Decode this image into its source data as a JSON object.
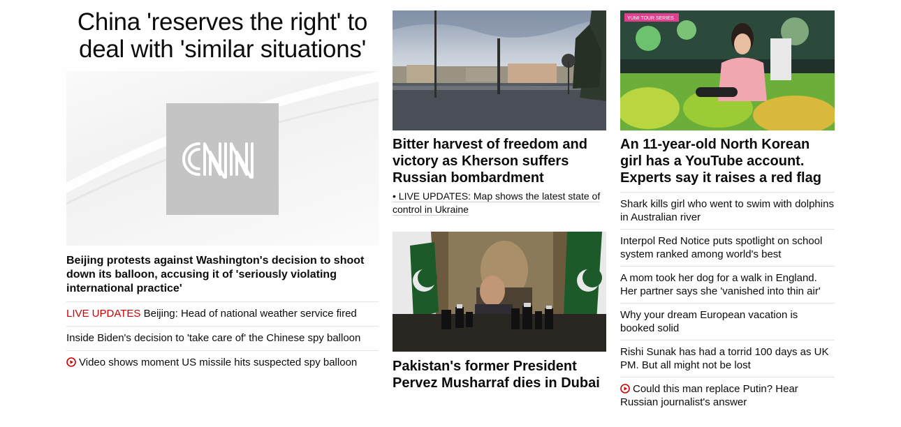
{
  "lead": {
    "headline": "China 'reserves the right' to deal with 'similar situations'",
    "logo_text": "CNN",
    "story_title": "Beijing protests against Washington's decision to shoot down its balloon, accusing it of 'seriously violating international practice'",
    "related": [
      {
        "tag": "LIVE UPDATES",
        "text": "Beijing: Head of national weather service fired"
      },
      {
        "text": "Inside Biden's decision to 'take care of' the Chinese spy balloon"
      },
      {
        "icon": "play-circle-icon",
        "text": "Video shows moment US missile hits suspected spy balloon"
      }
    ]
  },
  "middle": {
    "kherson": {
      "title": "Bitter harvest of freedom and victory as Kherson suffers Russian bombardment",
      "sub": "• LIVE UPDATES: Map shows the latest state of control in Ukraine"
    },
    "musharraf": {
      "title": "Pakistan's former President Pervez Musharraf dies in Dubai"
    }
  },
  "right": {
    "feature": {
      "badge_text": "YUMI TOUR SERIES",
      "title": "An 11-year-old North Korean girl has a YouTube account. Experts say it raises a red flag"
    },
    "stories": [
      "Shark kills girl who went to swim with dolphins in Australian river",
      "Interpol Red Notice puts spotlight on school system ranked among world's best",
      "A mom took her dog for a walk in England. Her partner says she 'vanished into thin air'",
      "Why your dream European vacation is booked solid",
      "Rishi Sunak has had a torrid 100 days as UK PM. But all might not be lost",
      "Could this man replace Putin? Hear Russian journalist's answer"
    ]
  },
  "colors": {
    "text": "#0c0c0c",
    "live_red": "#cc0000",
    "divider": "#e4e4e4",
    "logo_box": "#c4c4c4"
  }
}
